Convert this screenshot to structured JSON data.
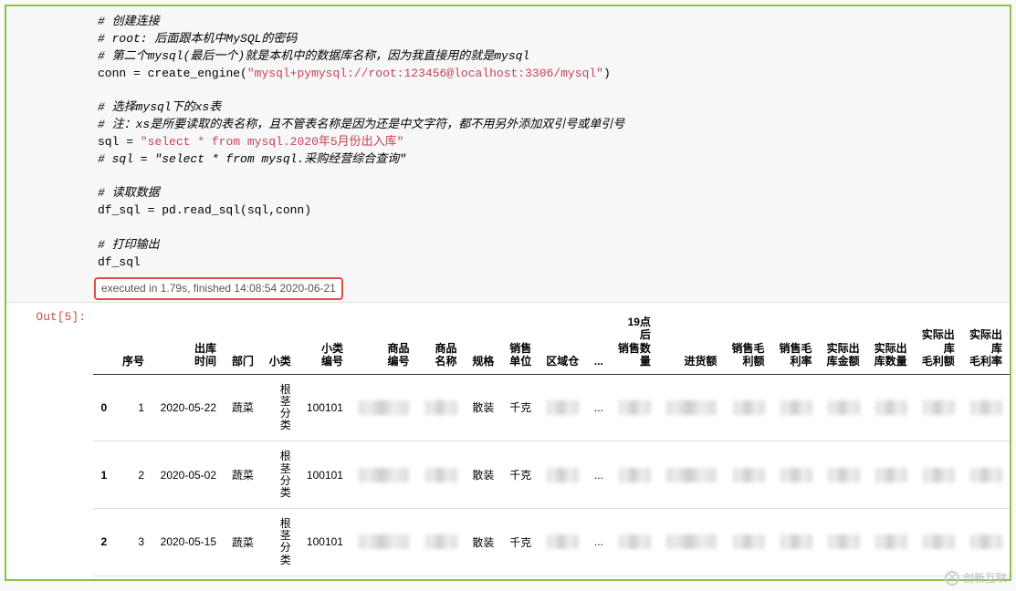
{
  "code": {
    "c1": "# 创建连接",
    "c2": "# root: 后面跟本机中MySQL的密码",
    "c3": "# 第二个mysql(最后一个)就是本机中的数据库名称，因为我直接用的就是mysql",
    "l4a": "conn ",
    "l4b": "=",
    "l4c": " create_engine(",
    "l4s": "\"mysql+pymysql://root:123456@localhost:3306/mysql\"",
    "l4d": ")",
    "c5": "# 选择mysql下的xs表",
    "c6": "# 注：xs是所要读取的表名称，且不管表名称是因为还是中文字符，都不用另外添加双引号或单引号",
    "l7a": "sql ",
    "l7b": "=",
    "l7c": " ",
    "l7s": "\"select * from mysql.2020年5月份出入库\"",
    "c8": "# sql = \"select * from mysql.采购经营综合查询\"",
    "c9": "# 读取数据",
    "l10": "df_sql = pd.read_sql(sql,conn)",
    "c11": "# 打印输出",
    "l12": "df_sql"
  },
  "exec_info": "executed in 1.79s, finished 14:08:54 2020-06-21",
  "out_prompt": "Out[5]:",
  "headers": {
    "h0": "",
    "h1": "序号",
    "h2": "出库时间",
    "h3": "部门",
    "h4": "小类",
    "h5": "小类编号",
    "h6": "商品编号",
    "h7": "商品名称",
    "h8": "规格",
    "h9": "销售单位",
    "h10": "区域仓",
    "h11": "...",
    "h12": "19点后销售数量",
    "h13": "进货额",
    "h14": "销售毛利额",
    "h15": "销售毛利率",
    "h16": "实际出库金额",
    "h17": "实际出库数量",
    "h18": "实际出库毛利额",
    "h19": "实际出库毛利率"
  },
  "rows": [
    {
      "idx": "0",
      "seq": "1",
      "date": "2020-05-22",
      "dept": "蔬菜",
      "subclass": "根茎分类",
      "subcode": "100101",
      "spec": "散装",
      "unit": "千克",
      "ell": "..."
    },
    {
      "idx": "1",
      "seq": "2",
      "date": "2020-05-02",
      "dept": "蔬菜",
      "subclass": "根茎分类",
      "subcode": "100101",
      "spec": "散装",
      "unit": "千克",
      "ell": "..."
    },
    {
      "idx": "2",
      "seq": "3",
      "date": "2020-05-15",
      "dept": "蔬菜",
      "subclass": "根茎分类",
      "subcode": "100101",
      "spec": "散装",
      "unit": "千克",
      "ell": "..."
    }
  ],
  "watermark": "创新互联"
}
